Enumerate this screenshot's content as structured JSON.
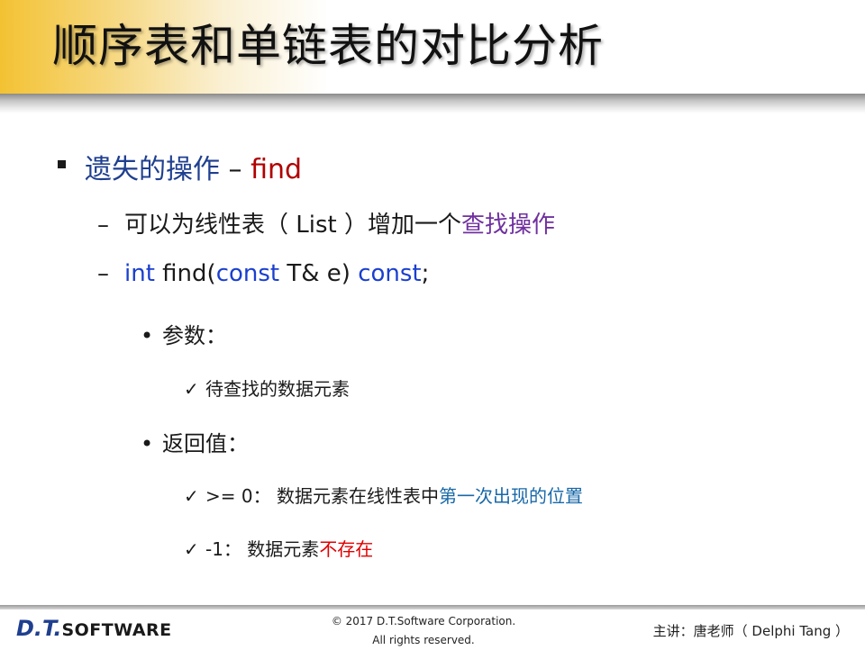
{
  "slide": {
    "title": "顺序表和单链表的对比分析",
    "bullets": {
      "main": {
        "text_prefix": "遗失的操作",
        "separator": " – ",
        "highlight": "find"
      },
      "sub1": {
        "dash": "–",
        "text": "可以为线性表（ List ）增加一个",
        "highlight": "查找操作"
      },
      "sub2": {
        "dash": "–",
        "kw_int": "int",
        "fn": " find(",
        "kw_const1": "const",
        "params": " T& e) ",
        "kw_const2": "const",
        "end": ";"
      },
      "params_label": {
        "dot": "•",
        "text": "参数："
      },
      "params_item": {
        "check": "✓",
        "text": "待查找的数据元素"
      },
      "return_label": {
        "dot": "•",
        "text": "返回值："
      },
      "return_item1": {
        "check": "✓",
        "text": ">= 0： 数据元素在线性表中",
        "highlight": "第一次出现的位置"
      },
      "return_item2": {
        "check": "✓",
        "text": "-1： 数据元素",
        "highlight": "不存在"
      }
    }
  },
  "footer": {
    "logo_dt": "D.T.",
    "logo_software": "SOFTWARE",
    "copyright_line1": "© 2017 D.T.Software Corporation.",
    "copyright_line2": "All rights reserved.",
    "lecturer": "主讲：唐老师（ Delphi Tang ）"
  },
  "colors": {
    "header_gold": "#f3c233",
    "blue_text": "#1f3f8f",
    "red_text": "#b00000",
    "purple_text": "#7030a0",
    "keyword_blue": "#1a3fcf",
    "cyan_text": "#1868a8",
    "bright_red": "#e00000"
  }
}
